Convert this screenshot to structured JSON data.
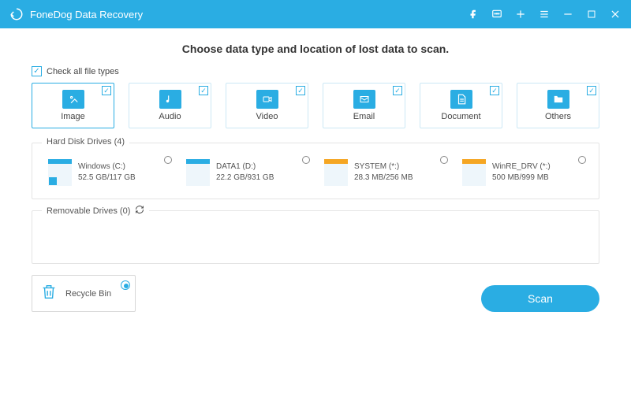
{
  "titlebar": {
    "title": "FoneDog Data Recovery"
  },
  "headline": "Choose data type and location of lost data to scan.",
  "checkall_label": "Check all file types",
  "types": [
    {
      "label": "Image"
    },
    {
      "label": "Audio"
    },
    {
      "label": "Video"
    },
    {
      "label": "Email"
    },
    {
      "label": "Document"
    },
    {
      "label": "Others"
    }
  ],
  "hdd_legend": "Hard Disk Drives (4)",
  "drives": [
    {
      "name": "Windows (C:)",
      "size": "52.5 GB/117 GB",
      "bar_color": "#2aade3",
      "os": true
    },
    {
      "name": "DATA1 (D:)",
      "size": "22.2 GB/931 GB",
      "bar_color": "#2aade3",
      "os": false
    },
    {
      "name": "SYSTEM (*:)",
      "size": "28.3 MB/256 MB",
      "bar_color": "#f5a623",
      "os": false
    },
    {
      "name": "WinRE_DRV (*:)",
      "size": "500 MB/999 MB",
      "bar_color": "#f5a623",
      "os": false
    }
  ],
  "removable_legend": "Removable Drives (0)",
  "recycle_label": "Recycle Bin",
  "scan_label": "Scan"
}
